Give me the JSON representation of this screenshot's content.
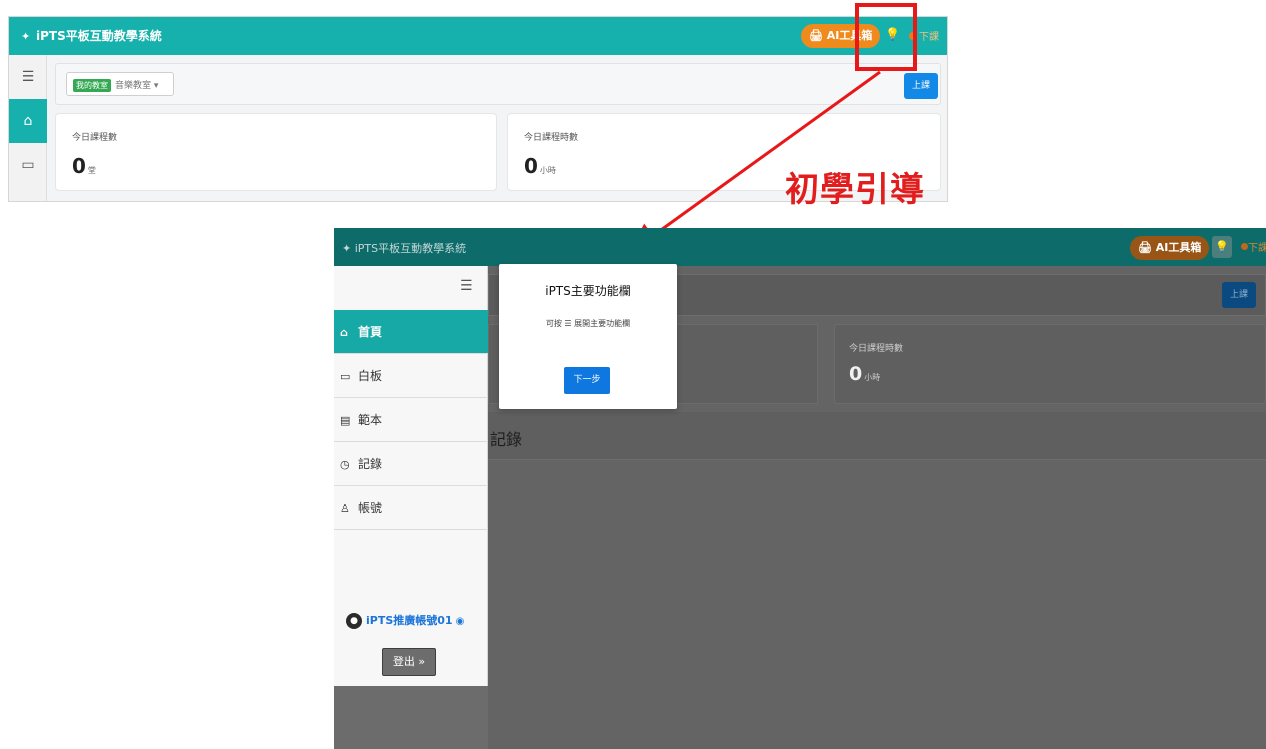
{
  "colors": {
    "teal": "#17b1ad",
    "teal_dimmed": "#0d6b6a",
    "orange": "#ef8a1d",
    "primary_blue": "#1289e7",
    "annotation_red": "#e81818",
    "overlay_gray": "#646464"
  },
  "annotation": {
    "label": "初學引導"
  },
  "shot1": {
    "brand": "iPTS平板互動教學系統",
    "ai_tools": "AI工具箱",
    "status": "下課",
    "room_tag": "我的教室",
    "room_name": "音樂教室",
    "start_button": "上課",
    "cards": [
      {
        "label": "今日課程數",
        "value": "0",
        "unit": "堂"
      },
      {
        "label": "今日課程時數",
        "value": "0",
        "unit": "小時"
      }
    ],
    "rail_icons": [
      "menu-icon",
      "home-icon",
      "whiteboard-icon"
    ]
  },
  "shot2": {
    "brand": "iPTS平板互動教學系統",
    "ai_tools": "AI工具箱",
    "status": "下課",
    "start_button": "上課",
    "card": {
      "label": "今日課程時數",
      "value": "0",
      "unit": "小時"
    },
    "records_title": "記錄",
    "nav": [
      {
        "icon": "home-icon",
        "label": "首頁"
      },
      {
        "icon": "whiteboard-icon",
        "label": "白板"
      },
      {
        "icon": "template-icon",
        "label": "範本"
      },
      {
        "icon": "history-icon",
        "label": "記錄"
      },
      {
        "icon": "account-icon",
        "label": "帳號"
      }
    ],
    "user_name": "iPTS推廣帳號01",
    "logout": "登出 »",
    "popover": {
      "title": "iPTS主要功能欄",
      "desc": "可按 ☰ 展開主要功能欄",
      "next": "下一步"
    }
  }
}
